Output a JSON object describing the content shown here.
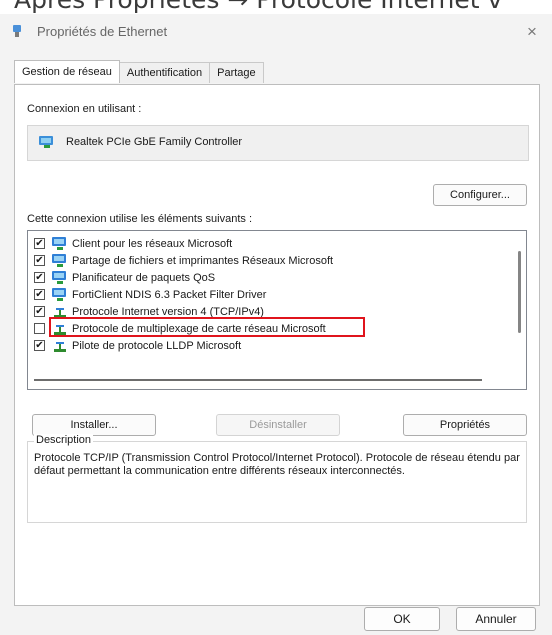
{
  "caption": "Après Propriétés → Protocole Internet v",
  "window": {
    "title": "Propriétés de Ethernet",
    "close_glyph": "×"
  },
  "tabs": [
    {
      "label": "Gestion de réseau"
    },
    {
      "label": "Authentification"
    },
    {
      "label": "Partage"
    }
  ],
  "connection": {
    "label": "Connexion en utilisant :",
    "adapter_name": "Realtek PCIe GbE Family Controller",
    "configure_label": "Configurer..."
  },
  "components": {
    "label": "Cette connexion utilise les éléments suivants :",
    "items": [
      {
        "label": "Client pour les réseaux Microsoft",
        "checked": true,
        "icon": "network-client-icon"
      },
      {
        "label": "Partage de fichiers et imprimantes Réseaux Microsoft",
        "checked": true,
        "icon": "network-service-icon"
      },
      {
        "label": "Planificateur de paquets QoS",
        "checked": true,
        "icon": "network-service-icon"
      },
      {
        "label": "FortiClient NDIS 6.3 Packet Filter Driver",
        "checked": true,
        "icon": "network-service-icon"
      },
      {
        "label": "Protocole Internet version 4 (TCP/IPv4)",
        "checked": true,
        "icon": "protocol-icon"
      },
      {
        "label": "Protocole de multiplexage de carte réseau Microsoft",
        "checked": false,
        "icon": "protocol-icon"
      },
      {
        "label": "Pilote de protocole LLDP Microsoft",
        "checked": true,
        "icon": "protocol-icon"
      }
    ]
  },
  "actions": {
    "install": "Installer...",
    "uninstall": "Désinstaller",
    "properties": "Propriétés"
  },
  "description": {
    "legend": "Description",
    "text": "Protocole TCP/IP (Transmission Control Protocol/Internet Protocol). Protocole de réseau étendu par défaut permettant la communication entre différents réseaux interconnectés."
  },
  "footer": {
    "ok": "OK",
    "cancel": "Annuler"
  },
  "colors": {
    "highlight": "#e0141c",
    "protocol_green": "#2e8b2e",
    "network_blue": "#2f7fd6"
  }
}
